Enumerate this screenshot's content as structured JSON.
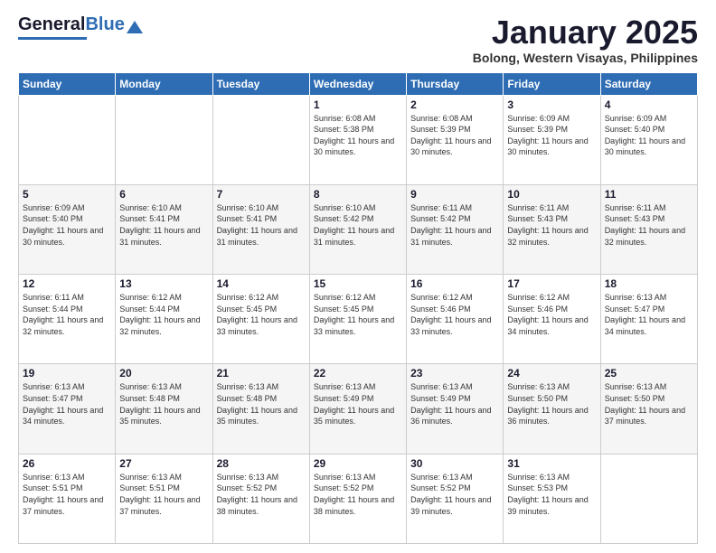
{
  "logo": {
    "text_general": "General",
    "text_blue": "Blue"
  },
  "header": {
    "title": "January 2025",
    "location": "Bolong, Western Visayas, Philippines"
  },
  "weekdays": [
    "Sunday",
    "Monday",
    "Tuesday",
    "Wednesday",
    "Thursday",
    "Friday",
    "Saturday"
  ],
  "weeks": [
    [
      {
        "day": "",
        "sunrise": "",
        "sunset": "",
        "daylight": ""
      },
      {
        "day": "",
        "sunrise": "",
        "sunset": "",
        "daylight": ""
      },
      {
        "day": "",
        "sunrise": "",
        "sunset": "",
        "daylight": ""
      },
      {
        "day": "1",
        "sunrise": "6:08 AM",
        "sunset": "5:38 PM",
        "daylight": "11 hours and 30 minutes."
      },
      {
        "day": "2",
        "sunrise": "6:08 AM",
        "sunset": "5:39 PM",
        "daylight": "11 hours and 30 minutes."
      },
      {
        "day": "3",
        "sunrise": "6:09 AM",
        "sunset": "5:39 PM",
        "daylight": "11 hours and 30 minutes."
      },
      {
        "day": "4",
        "sunrise": "6:09 AM",
        "sunset": "5:40 PM",
        "daylight": "11 hours and 30 minutes."
      }
    ],
    [
      {
        "day": "5",
        "sunrise": "6:09 AM",
        "sunset": "5:40 PM",
        "daylight": "11 hours and 30 minutes."
      },
      {
        "day": "6",
        "sunrise": "6:10 AM",
        "sunset": "5:41 PM",
        "daylight": "11 hours and 31 minutes."
      },
      {
        "day": "7",
        "sunrise": "6:10 AM",
        "sunset": "5:41 PM",
        "daylight": "11 hours and 31 minutes."
      },
      {
        "day": "8",
        "sunrise": "6:10 AM",
        "sunset": "5:42 PM",
        "daylight": "11 hours and 31 minutes."
      },
      {
        "day": "9",
        "sunrise": "6:11 AM",
        "sunset": "5:42 PM",
        "daylight": "11 hours and 31 minutes."
      },
      {
        "day": "10",
        "sunrise": "6:11 AM",
        "sunset": "5:43 PM",
        "daylight": "11 hours and 32 minutes."
      },
      {
        "day": "11",
        "sunrise": "6:11 AM",
        "sunset": "5:43 PM",
        "daylight": "11 hours and 32 minutes."
      }
    ],
    [
      {
        "day": "12",
        "sunrise": "6:11 AM",
        "sunset": "5:44 PM",
        "daylight": "11 hours and 32 minutes."
      },
      {
        "day": "13",
        "sunrise": "6:12 AM",
        "sunset": "5:44 PM",
        "daylight": "11 hours and 32 minutes."
      },
      {
        "day": "14",
        "sunrise": "6:12 AM",
        "sunset": "5:45 PM",
        "daylight": "11 hours and 33 minutes."
      },
      {
        "day": "15",
        "sunrise": "6:12 AM",
        "sunset": "5:45 PM",
        "daylight": "11 hours and 33 minutes."
      },
      {
        "day": "16",
        "sunrise": "6:12 AM",
        "sunset": "5:46 PM",
        "daylight": "11 hours and 33 minutes."
      },
      {
        "day": "17",
        "sunrise": "6:12 AM",
        "sunset": "5:46 PM",
        "daylight": "11 hours and 34 minutes."
      },
      {
        "day": "18",
        "sunrise": "6:13 AM",
        "sunset": "5:47 PM",
        "daylight": "11 hours and 34 minutes."
      }
    ],
    [
      {
        "day": "19",
        "sunrise": "6:13 AM",
        "sunset": "5:47 PM",
        "daylight": "11 hours and 34 minutes."
      },
      {
        "day": "20",
        "sunrise": "6:13 AM",
        "sunset": "5:48 PM",
        "daylight": "11 hours and 35 minutes."
      },
      {
        "day": "21",
        "sunrise": "6:13 AM",
        "sunset": "5:48 PM",
        "daylight": "11 hours and 35 minutes."
      },
      {
        "day": "22",
        "sunrise": "6:13 AM",
        "sunset": "5:49 PM",
        "daylight": "11 hours and 35 minutes."
      },
      {
        "day": "23",
        "sunrise": "6:13 AM",
        "sunset": "5:49 PM",
        "daylight": "11 hours and 36 minutes."
      },
      {
        "day": "24",
        "sunrise": "6:13 AM",
        "sunset": "5:50 PM",
        "daylight": "11 hours and 36 minutes."
      },
      {
        "day": "25",
        "sunrise": "6:13 AM",
        "sunset": "5:50 PM",
        "daylight": "11 hours and 37 minutes."
      }
    ],
    [
      {
        "day": "26",
        "sunrise": "6:13 AM",
        "sunset": "5:51 PM",
        "daylight": "11 hours and 37 minutes."
      },
      {
        "day": "27",
        "sunrise": "6:13 AM",
        "sunset": "5:51 PM",
        "daylight": "11 hours and 37 minutes."
      },
      {
        "day": "28",
        "sunrise": "6:13 AM",
        "sunset": "5:52 PM",
        "daylight": "11 hours and 38 minutes."
      },
      {
        "day": "29",
        "sunrise": "6:13 AM",
        "sunset": "5:52 PM",
        "daylight": "11 hours and 38 minutes."
      },
      {
        "day": "30",
        "sunrise": "6:13 AM",
        "sunset": "5:52 PM",
        "daylight": "11 hours and 39 minutes."
      },
      {
        "day": "31",
        "sunrise": "6:13 AM",
        "sunset": "5:53 PM",
        "daylight": "11 hours and 39 minutes."
      },
      {
        "day": "",
        "sunrise": "",
        "sunset": "",
        "daylight": ""
      }
    ]
  ],
  "labels": {
    "sunrise": "Sunrise:",
    "sunset": "Sunset:",
    "daylight": "Daylight:"
  }
}
